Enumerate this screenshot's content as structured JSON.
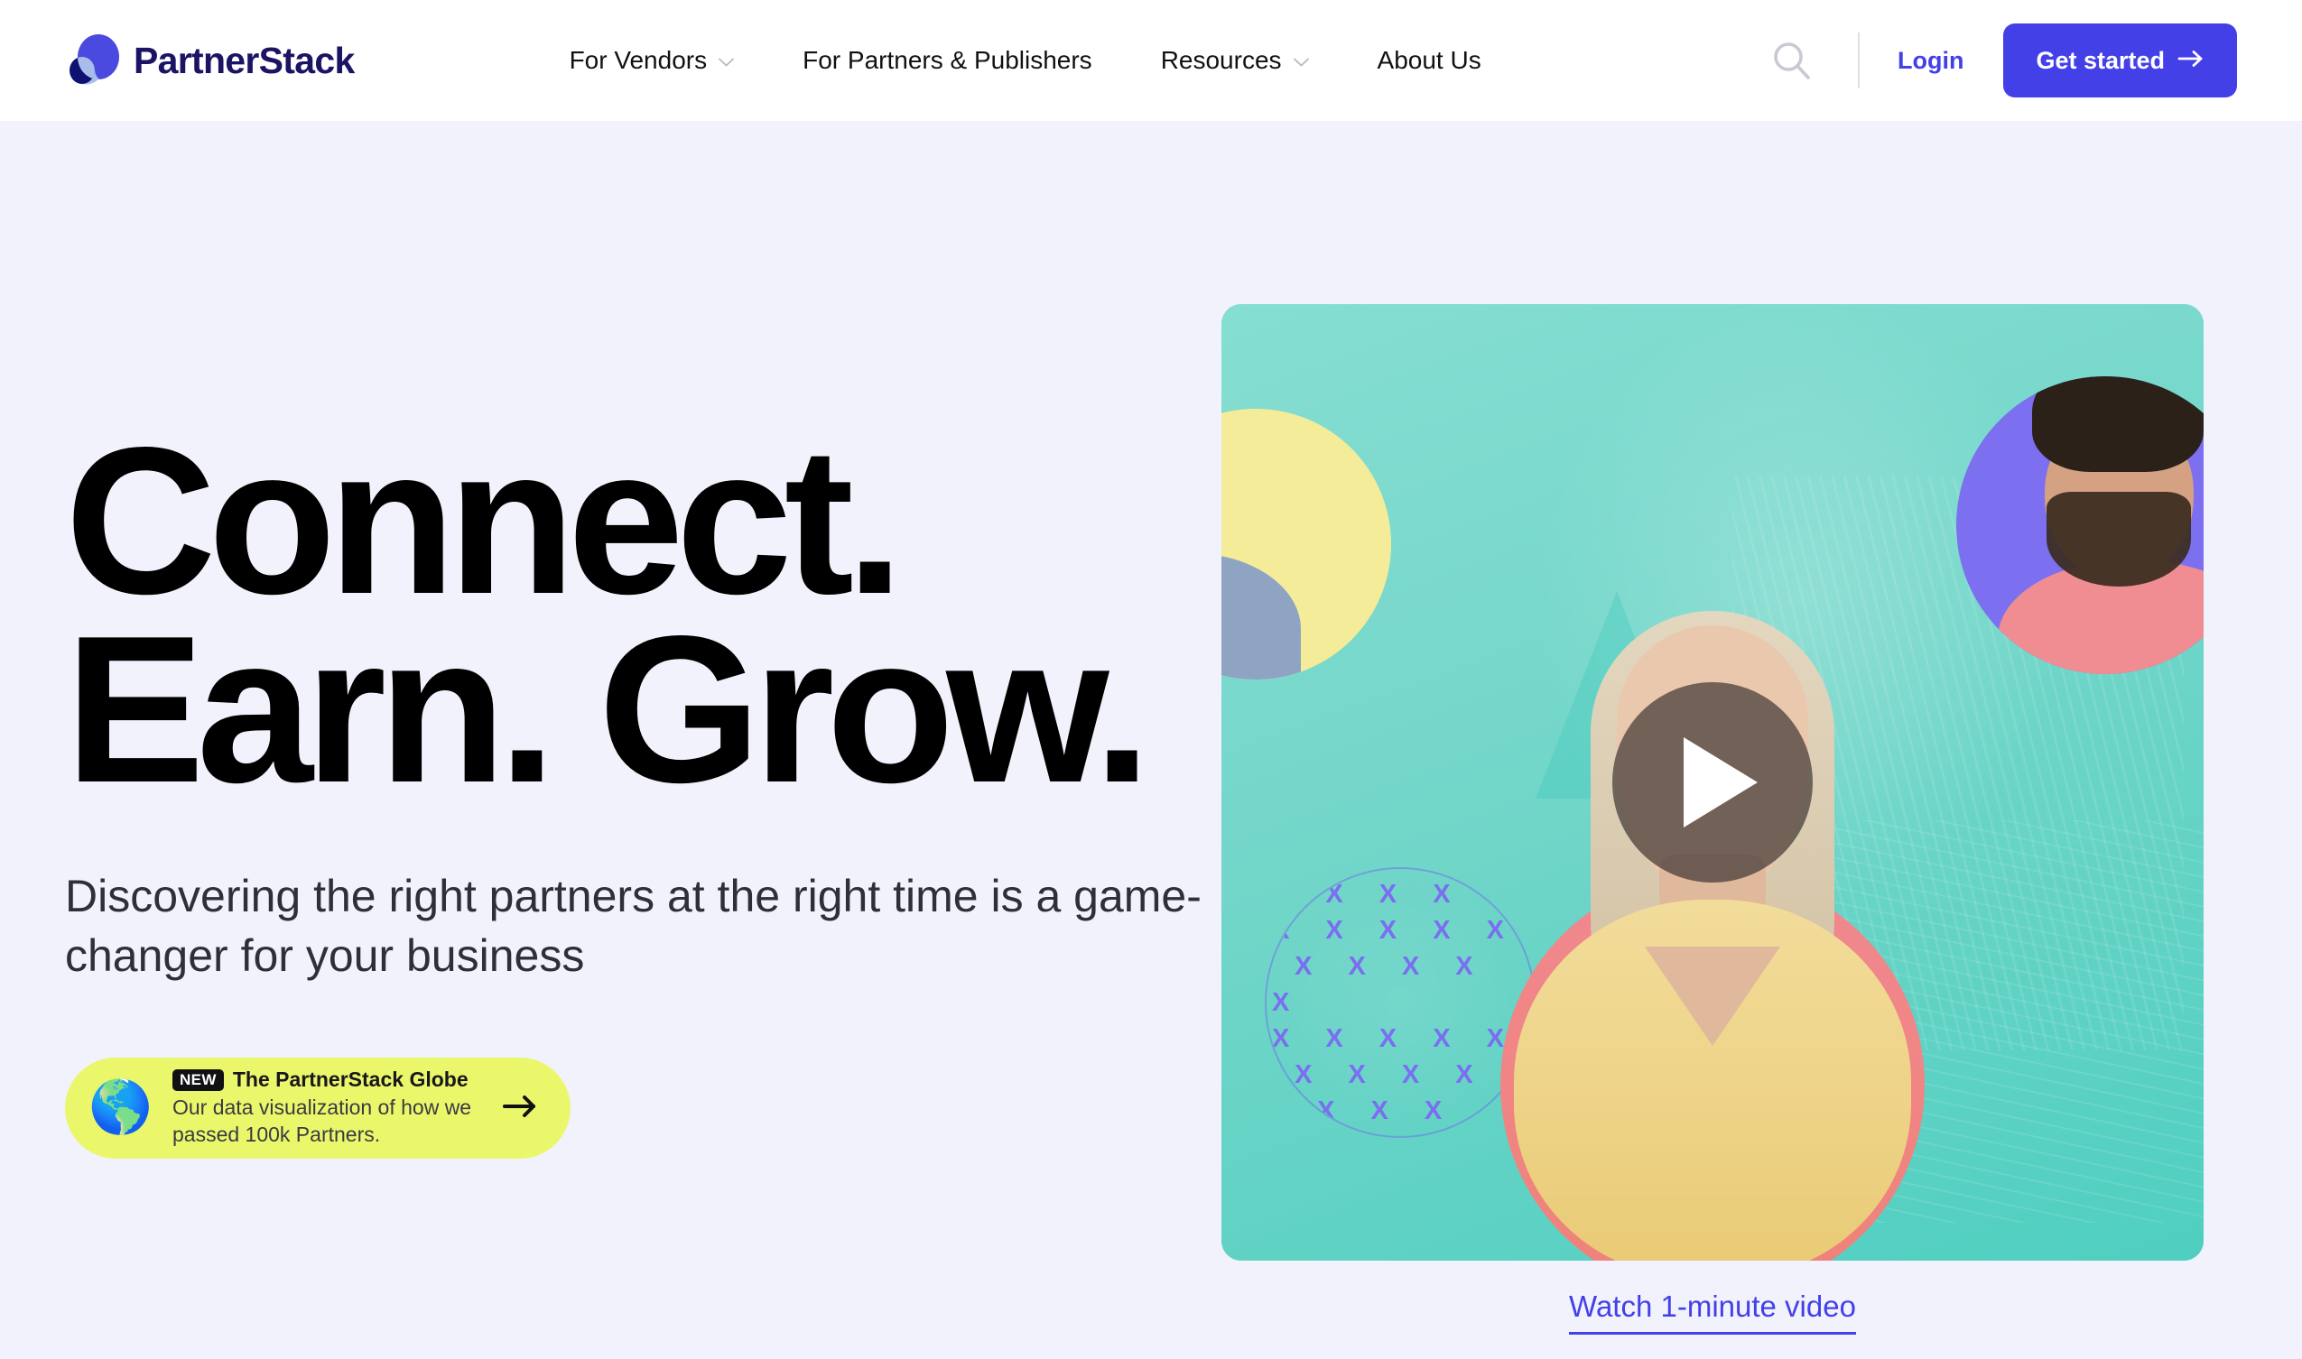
{
  "brand": {
    "name": "PartnerStack",
    "logo_icon": "partnerstack-overlapping-circles-logo",
    "primary_color": "#4340e8",
    "logo_text_color": "#1b1464"
  },
  "header": {
    "nav_items": [
      {
        "label": "For Vendors",
        "has_dropdown": true,
        "icon": "chevron-down-icon"
      },
      {
        "label": "For Partners & Publishers",
        "has_dropdown": false
      },
      {
        "label": "Resources",
        "has_dropdown": true,
        "icon": "chevron-down-icon"
      },
      {
        "label": "About Us",
        "has_dropdown": false
      }
    ],
    "search_icon": "search-icon",
    "login_label": "Login",
    "cta_label": "Get started",
    "cta_icon": "arrow-right-icon"
  },
  "hero": {
    "headline_line1": "Connect.",
    "headline_line2": "Earn. Grow.",
    "subheadline": "Discovering the right partners at the right time is a game-changer for your business",
    "background_color": "#f2f2fd"
  },
  "globe_pill": {
    "emoji": "🌎",
    "badge": "NEW",
    "title": "The PartnerStack Globe",
    "description": "Our data visualization of how we passed 100k Partners.",
    "arrow_icon": "arrow-right-icon",
    "background_color": "#ebf76b"
  },
  "video": {
    "play_icon": "play-icon",
    "watch_label": "Watch 1-minute video",
    "x_pattern": "X X X X\nX X X X X\n X X X X X\nX X X X X\n X X X X\n  X X X"
  }
}
